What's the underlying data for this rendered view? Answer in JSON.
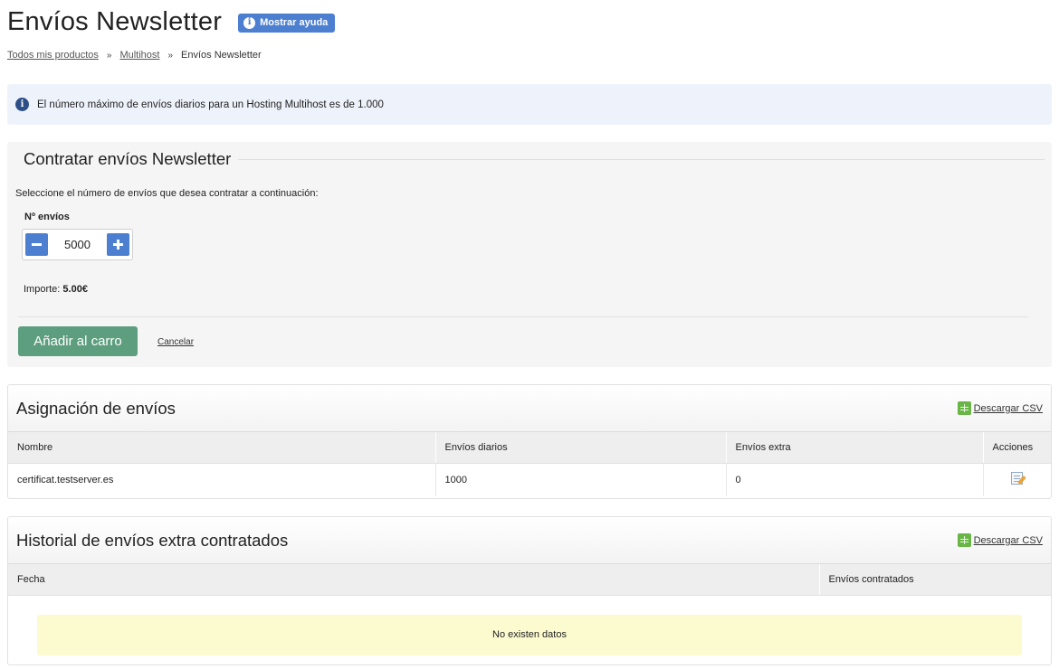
{
  "header": {
    "title": "Envíos Newsletter",
    "help_label": "Mostrar ayuda"
  },
  "breadcrumb": {
    "items": [
      "Todos mis productos",
      "Multihost",
      "Envíos Newsletter"
    ],
    "separator": "»"
  },
  "info_alert": {
    "text": "El número máximo de envíos diarios para un Hosting Multihost es de 1.000"
  },
  "contract": {
    "title": "Contratar envíos Newsletter",
    "description": "Seleccione el número de envíos que desea contratar a continuación:",
    "qty_label": "Nº envíos",
    "qty_value": "5000",
    "amount_label": "Importe:",
    "amount_value": "5.00€",
    "add_to_cart_label": "Añadir al carro",
    "cancel_label": "Cancelar"
  },
  "assignment": {
    "title": "Asignación de envíos",
    "csv_label": "Descargar CSV",
    "columns": [
      "Nombre",
      "Envíos diarios",
      "Envíos extra",
      "Acciones"
    ],
    "rows": [
      {
        "name": "certificat.testserver.es",
        "daily": "1000",
        "extra": "0"
      }
    ]
  },
  "history": {
    "title": "Historial de envíos extra contratados",
    "csv_label": "Descargar CSV",
    "columns": [
      "Fecha",
      "Envíos contratados"
    ],
    "empty_text": "No existen datos"
  },
  "colors": {
    "accent_blue": "#4d7fd1",
    "button_green": "#5c9e7e",
    "info_bg": "#eef3fb",
    "empty_bg": "#fcfbd0"
  },
  "icons": {
    "help": "info-icon",
    "alert": "info-icon",
    "stepper_minus": "minus-icon",
    "stepper_plus": "plus-icon",
    "csv": "spreadsheet-icon",
    "row_action": "edit-icon"
  }
}
